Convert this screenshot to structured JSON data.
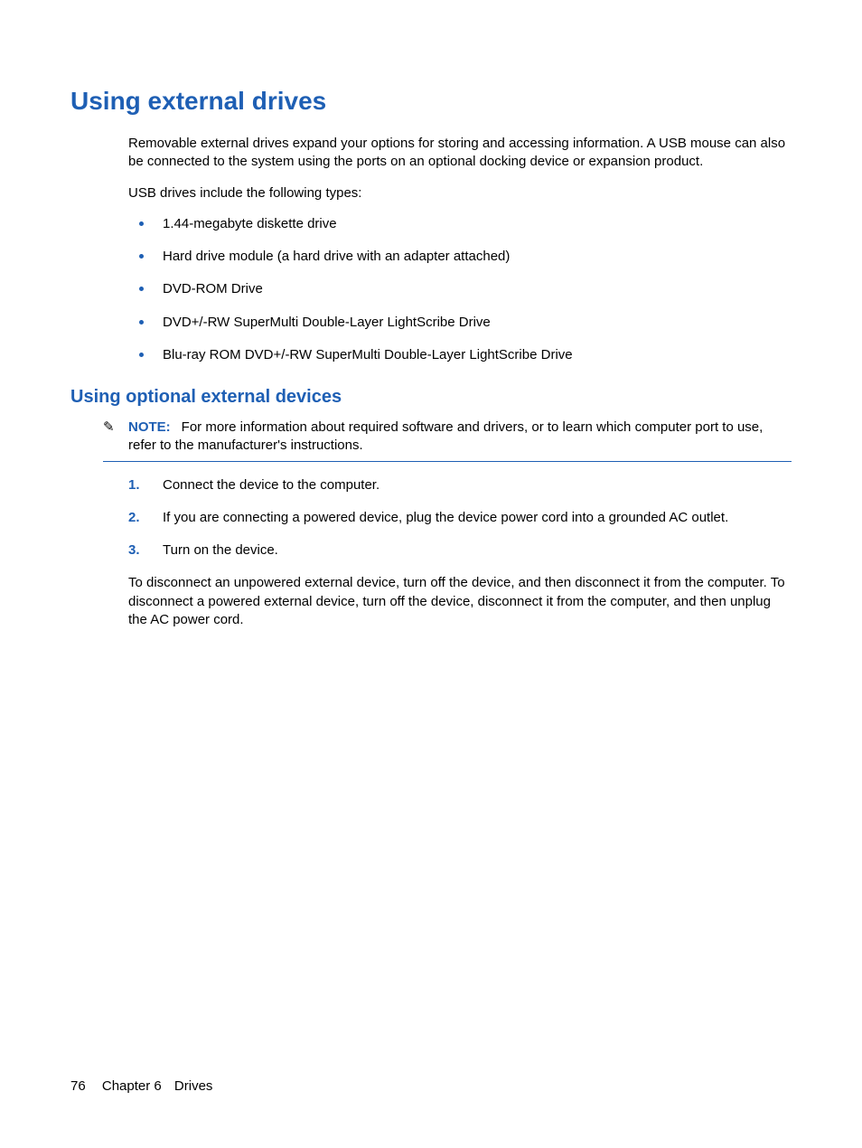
{
  "heading1": "Using external drives",
  "intro_para": "Removable external drives expand your options for storing and accessing information. A USB mouse can also be connected to the system using the ports on an optional docking device or expansion product.",
  "types_para": "USB drives include the following types:",
  "bullets": [
    "1.44-megabyte diskette drive",
    "Hard drive module (a hard drive with an adapter attached)",
    "DVD-ROM Drive",
    "DVD+/-RW SuperMulti Double-Layer LightScribe Drive",
    "Blu-ray ROM DVD+/-RW SuperMulti Double-Layer LightScribe Drive"
  ],
  "heading2": "Using optional external devices",
  "note": {
    "label": "NOTE:",
    "text": "For more information about required software and drivers, or to learn which computer port to use, refer to the manufacturer's instructions."
  },
  "steps": [
    "Connect the device to the computer.",
    "If you are connecting a powered device, plug the device power cord into a grounded AC outlet.",
    "Turn on the device."
  ],
  "disconnect_para": "To disconnect an unpowered external device, turn off the device, and then disconnect it from the computer. To disconnect a powered external device, turn off the device, disconnect it from the computer, and then unplug the AC power cord.",
  "footer": {
    "page": "76",
    "chapter": "Chapter 6",
    "title": "Drives"
  }
}
